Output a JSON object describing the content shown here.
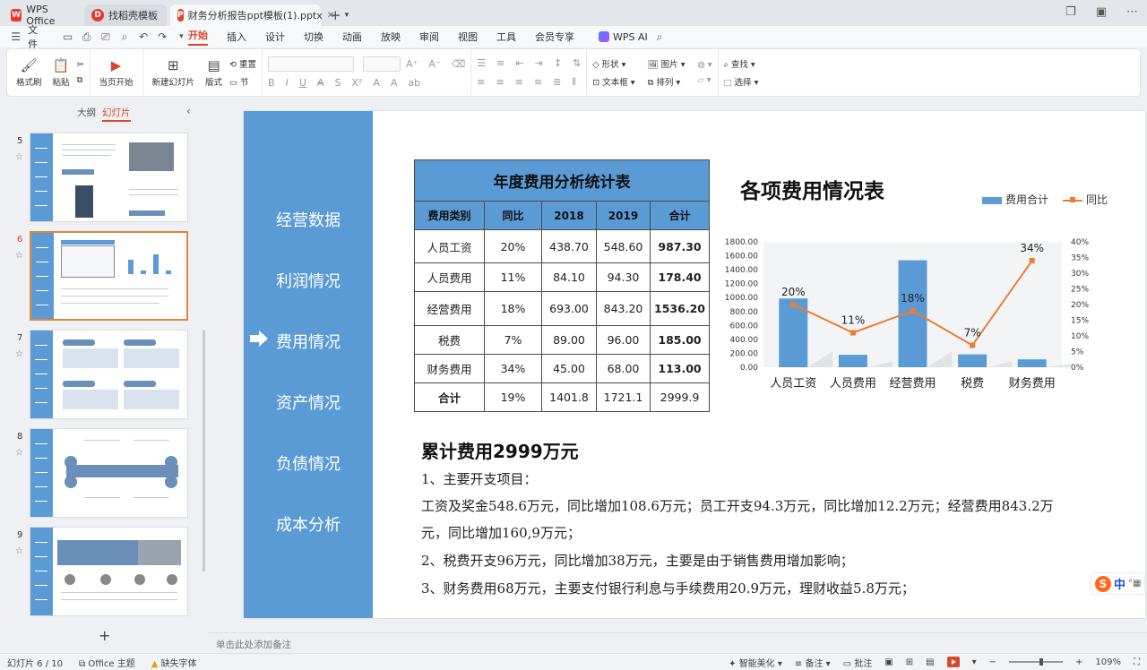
{
  "tabs": [
    {
      "label": "WPS Office",
      "icon": "wps-logo-icon"
    },
    {
      "label": "找稻壳模板",
      "icon": "docer-icon"
    },
    {
      "label": "财务分析报告ppt模板(1).pptx",
      "icon": "ppt-file-icon"
    }
  ],
  "menu": {
    "file": "文件",
    "items": [
      "开始",
      "插入",
      "设计",
      "切换",
      "动画",
      "放映",
      "审阅",
      "视图",
      "工具",
      "会员专享"
    ],
    "active": "开始",
    "ai_label": "WPS AI"
  },
  "ribbon": {
    "format_painter": "格式刷",
    "paste": "粘贴",
    "from_current": "当页开始",
    "new_slide": "新建幻灯片",
    "layout": "版式",
    "reset": "重置",
    "section": "节",
    "shape": "形状",
    "picture": "图片",
    "textbox": "文本框",
    "arrange": "排列",
    "find": "查找",
    "select": "选择"
  },
  "pane": {
    "outline_tab": "大纲",
    "slides_tab": "幻灯片",
    "thumbnails": [
      {
        "num": "5",
        "active": false
      },
      {
        "num": "6",
        "active": true
      },
      {
        "num": "7",
        "active": false
      },
      {
        "num": "8",
        "active": false
      },
      {
        "num": "9",
        "active": false
      }
    ]
  },
  "slide": {
    "nav": [
      "经营数据",
      "利润情况",
      "费用情况",
      "资产情况",
      "负债情况",
      "成本分析"
    ],
    "nav_current_index": 2,
    "table": {
      "title": "年度费用分析统计表",
      "headers": [
        "费用类别",
        "同比",
        "2018",
        "2019",
        "合计"
      ],
      "rows": [
        [
          "人员工资",
          "20%",
          "438.70",
          "548.60",
          "987.30"
        ],
        [
          "人员费用",
          "11%",
          "84.10",
          "94.30",
          "178.40"
        ],
        [
          "经营费用",
          "18%",
          "693.00",
          "843.20",
          "1536.20"
        ],
        [
          "税费",
          "7%",
          "89.00",
          "96.00",
          "185.00"
        ],
        [
          "财务费用",
          "34%",
          "45.00",
          "68.00",
          "113.00"
        ],
        [
          "合计",
          "19%",
          "1401.8",
          "1721.1",
          "2999.9"
        ]
      ]
    },
    "summary_title": "累计费用2999万元",
    "paragraphs": [
      "1、主要开支项目：",
      "工资及奖金548.6万元，同比增加108.6万元；员工开支94.3万元，同比增加12.2万元；经营费用843.2万",
      "元，同比增加160,9万元；",
      "2、税费开支96万元，同比增加38万元，主要是由于销售费用增加影响；",
      "3、财务费用68万元，主要支付银行利息与手续费用20.9万元，理财收益5.8万元；"
    ]
  },
  "chart_data": {
    "type": "bar",
    "title": "各项费用情况表",
    "categories": [
      "人员工资",
      "人员费用",
      "经营费用",
      "税费",
      "财务费用"
    ],
    "series": [
      {
        "name": "费用合计",
        "type": "bar",
        "axis": "left",
        "values": [
          987.3,
          178.4,
          1536.2,
          185.0,
          113.0
        ]
      },
      {
        "name": "同比",
        "type": "line",
        "axis": "right",
        "values": [
          20,
          11,
          18,
          7,
          34
        ],
        "labels": [
          "20%",
          "11%",
          "18%",
          "7%",
          "34%"
        ]
      }
    ],
    "y_left": {
      "min": 0,
      "max": 1800,
      "ticks": [
        "0.00",
        "200.00",
        "400.00",
        "600.00",
        "800.00",
        "1000.00",
        "1200.00",
        "1400.00",
        "1600.00",
        "1800.00"
      ]
    },
    "y_right": {
      "min": 0,
      "max": 40,
      "ticks": [
        "0%",
        "5%",
        "10%",
        "15%",
        "20%",
        "25%",
        "30%",
        "35%",
        "40%"
      ]
    },
    "colors": {
      "bar": "#5b9bd5",
      "line": "#ed7d31"
    },
    "legend": "top-right"
  },
  "notes_placeholder": "单击此处添加备注",
  "status": {
    "slide_counter": "幻灯片 6 / 10",
    "theme": "Office 主题",
    "missing_font": "缺失字体",
    "beautify": "智能美化",
    "notes": "备注",
    "comments": "批注",
    "zoom": "109%"
  },
  "ime": {
    "label": "中"
  }
}
